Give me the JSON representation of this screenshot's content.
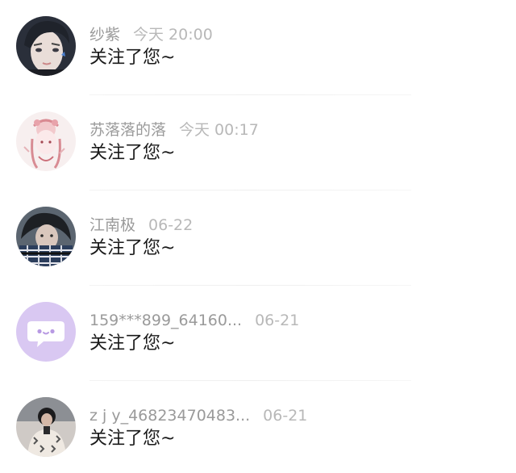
{
  "notifications": [
    {
      "username": "纱紫",
      "time": "今天 20:00",
      "message": "关注了您~",
      "avatar": "avatar-portrait-dark-hair"
    },
    {
      "username": "苏落落的落",
      "time": "今天 00:17",
      "message": "关注了您~",
      "avatar": "avatar-anime-pink-sketch"
    },
    {
      "username": "江南极",
      "time": "06-22",
      "message": "关注了您~",
      "avatar": "avatar-portrait-plaid-scarf"
    },
    {
      "username": "159***899_64160...",
      "time": "06-21",
      "message": "关注了您~",
      "avatar": "default-chat-bubble-avatar",
      "avatar_color": "#d9c8f2"
    },
    {
      "username": "z j y_46823470483...",
      "time": "06-21",
      "message": "关注了您~",
      "avatar": "avatar-person-dark-jacket"
    }
  ]
}
